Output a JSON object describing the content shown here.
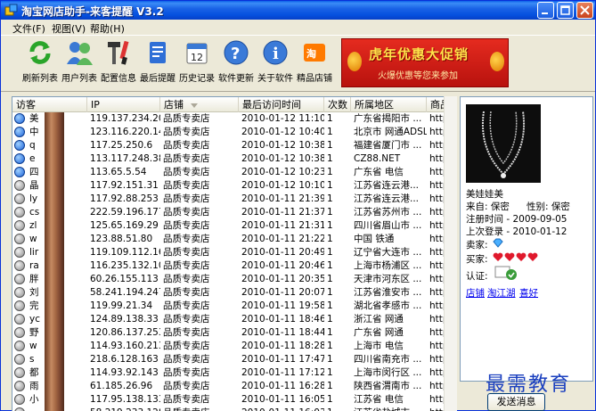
{
  "window": {
    "title": "淘宝网店助手-来客提醒  V3.2",
    "icon": "app-icon"
  },
  "menu": [
    {
      "label": "文件(F)"
    },
    {
      "label": "视图(V)"
    },
    {
      "label": "帮助(H)"
    }
  ],
  "toolbar": [
    {
      "label": "刷新列表",
      "icon": "refresh-icon"
    },
    {
      "label": "用户列表",
      "icon": "users-icon"
    },
    {
      "label": "配置信息",
      "icon": "tools-icon"
    },
    {
      "label": "最后提醒",
      "icon": "document-icon"
    },
    {
      "label": "历史记录",
      "icon": "calendar-icon"
    },
    {
      "label": "软件更新",
      "icon": "help-icon"
    },
    {
      "label": "关于软件",
      "icon": "info-icon"
    },
    {
      "label": "精品店铺",
      "icon": "taobao-icon"
    }
  ],
  "banner": {
    "main": "虎年优惠大促销",
    "sub": "火爆优惠等您来参加"
  },
  "table": {
    "columns": [
      "访客",
      "IP",
      "店铺",
      "最后访问时间",
      "次数",
      "所属地区",
      "商品"
    ],
    "rows": [
      {
        "visitor": "美",
        "ip": "119.137.234.207",
        "shop": "品质专卖店",
        "time": "2010-01-12 11:10:30",
        "count": "1",
        "region": "广东省揭阳市 ...",
        "item": "http",
        "icon": "blue"
      },
      {
        "visitor": "中",
        "ip": "123.116.220.147",
        "shop": "品质专卖店",
        "time": "2010-01-12 10:40:18",
        "count": "1",
        "region": "北京市 网通ADSL",
        "item": "http",
        "icon": "blue"
      },
      {
        "visitor": "q",
        "ip": "117.25.250.6",
        "shop": "品质专卖店",
        "time": "2010-01-12 10:38:50",
        "count": "1",
        "region": "福建省厦门市 ...",
        "item": "http",
        "icon": "blue"
      },
      {
        "visitor": "e",
        "ip": "113.117.248.38",
        "shop": "品质专卖店",
        "time": "2010-01-12 10:38:04",
        "count": "1",
        "region": "CZ88.NET",
        "item": "http",
        "icon": "blue"
      },
      {
        "visitor": "四",
        "ip": "113.65.5.54",
        "shop": "品质专卖店",
        "time": "2010-01-12 10:23:18",
        "count": "1",
        "region": "广东省 电信",
        "item": "http",
        "icon": "blue"
      },
      {
        "visitor": "晶",
        "ip": "117.92.151.31",
        "shop": "品质专卖店",
        "time": "2010-01-12 10:10:27",
        "count": "1",
        "region": "江苏省连云港...",
        "item": "http",
        "icon": "gray"
      },
      {
        "visitor": "ly",
        "ip": "117.92.88.253",
        "shop": "品质专卖店",
        "time": "2010-01-11 21:39:10",
        "count": "1",
        "region": "江苏省连云港...",
        "item": "http",
        "icon": "gray"
      },
      {
        "visitor": "cs",
        "ip": "222.59.196.177",
        "shop": "品质专卖店",
        "time": "2010-01-11 21:37:16",
        "count": "1",
        "region": "江苏省苏州市 ...",
        "item": "http",
        "icon": "gray"
      },
      {
        "visitor": "zl",
        "ip": "125.65.169.29",
        "shop": "品质专卖店",
        "time": "2010-01-11 21:31:24",
        "count": "1",
        "region": "四川省眉山市 ...",
        "item": "http",
        "icon": "gray"
      },
      {
        "visitor": "w",
        "ip": "123.88.51.80",
        "shop": "品质专卖店",
        "time": "2010-01-11 21:22:24",
        "count": "1",
        "region": "中国 铁通",
        "item": "http",
        "icon": "gray"
      },
      {
        "visitor": "lir",
        "ip": "119.109.112.165",
        "shop": "品质专卖店",
        "time": "2010-01-11 20:49:43",
        "count": "1",
        "region": "辽宁省大连市 ...",
        "item": "http",
        "icon": "gray"
      },
      {
        "visitor": "ra",
        "ip": "116.235.132.105",
        "shop": "品质专卖店",
        "time": "2010-01-11 20:46:32",
        "count": "1",
        "region": "上海市杨浦区 ...",
        "item": "http",
        "icon": "gray"
      },
      {
        "visitor": "胖",
        "ip": "60.26.155.113",
        "shop": "品质专卖店",
        "time": "2010-01-11 20:35:23",
        "count": "1",
        "region": "天津市河东区 ...",
        "item": "http",
        "icon": "gray"
      },
      {
        "visitor": "刘",
        "ip": "58.241.194.247",
        "shop": "品质专卖店",
        "time": "2010-01-11 20:07:38",
        "count": "1",
        "region": "江苏省淮安市 ...",
        "item": "http",
        "icon": "gray"
      },
      {
        "visitor": "完",
        "ip": "119.99.21.34",
        "shop": "品质专卖店",
        "time": "2010-01-11 19:58:23",
        "count": "1",
        "region": "湖北省孝感市 ...",
        "item": "http",
        "icon": "gray"
      },
      {
        "visitor": "yc",
        "ip": "124.89.138.33",
        "shop": "品质专卖店",
        "time": "2010-01-11 18:46:34",
        "count": "1",
        "region": "浙江省 网通",
        "item": "http",
        "icon": "gray"
      },
      {
        "visitor": "野",
        "ip": "120.86.137.253",
        "shop": "品质专卖店",
        "time": "2010-01-11 18:44:38",
        "count": "1",
        "region": "广东省 网通",
        "item": "http",
        "icon": "gray"
      },
      {
        "visitor": "w",
        "ip": "114.93.160.213",
        "shop": "品质专卖店",
        "time": "2010-01-11 18:28:16",
        "count": "1",
        "region": "上海市 电信",
        "item": "http",
        "icon": "gray"
      },
      {
        "visitor": "s",
        "ip": "218.6.128.163",
        "shop": "品质专卖店",
        "time": "2010-01-11 17:47:07",
        "count": "1",
        "region": "四川省南充市 ...",
        "item": "http",
        "icon": "gray"
      },
      {
        "visitor": "都",
        "ip": "114.93.92.143",
        "shop": "品质专卖店",
        "time": "2010-01-11 17:12:28",
        "count": "1",
        "region": "上海市闵行区 ...",
        "item": "http",
        "icon": "gray"
      },
      {
        "visitor": "雨",
        "ip": "61.185.26.96",
        "shop": "品质专卖店",
        "time": "2010-01-11 16:28:34",
        "count": "1",
        "region": "陕西省渭南市 ...",
        "item": "http",
        "icon": "gray"
      },
      {
        "visitor": "小",
        "ip": "117.95.138.133",
        "shop": "品质专卖店",
        "time": "2010-01-11 16:05:34",
        "count": "1",
        "region": "江苏省 电信",
        "item": "http",
        "icon": "gray"
      },
      {
        "visitor": "",
        "ip": "58.219.233.128",
        "shop": "品质专卖店",
        "time": "2010-01-11 16:03:43",
        "count": "1",
        "region": "江苏省盐城市",
        "item": "http",
        "icon": "gray"
      }
    ]
  },
  "profile": {
    "name": "美娃娃美",
    "source": "来自: 保密",
    "gender": "性别: 保密",
    "registered": "注册时间 - 2009-09-05",
    "last_login": "上次登录 - 2010-01-12",
    "seller_label": "卖家:",
    "buyer_label": "买家:",
    "verify_label": "认证:",
    "links": [
      "店铺",
      "淘江湖",
      "喜好"
    ]
  },
  "send_button": "发送消息",
  "watermark": "最需教育",
  "colors": {
    "titlebar": "#0a5fe8",
    "banner": "#e52b1f",
    "link": "#0000ee"
  }
}
